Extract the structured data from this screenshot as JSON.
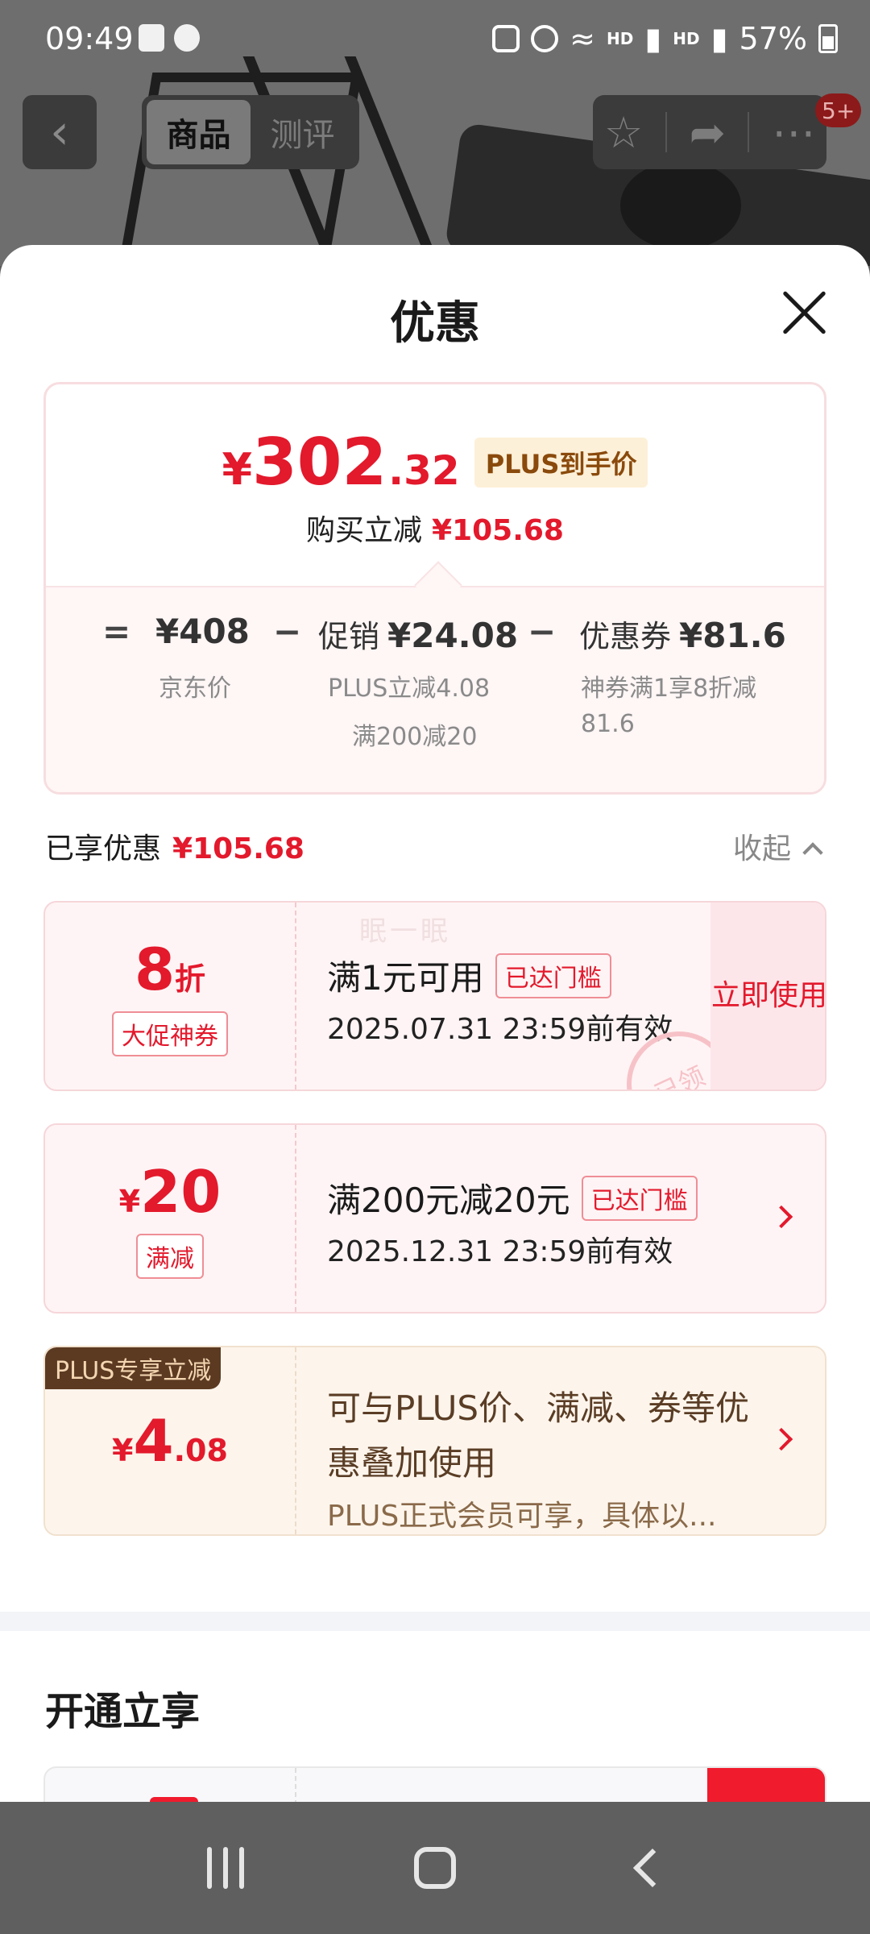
{
  "status_bar": {
    "time": "09:49",
    "battery": "57%",
    "network_a": "HD",
    "network_b": "HD"
  },
  "top_nav": {
    "tabs": [
      {
        "label": "商品",
        "active": true
      },
      {
        "label": "测评",
        "active": false
      }
    ],
    "more_badge": "5+"
  },
  "sheet": {
    "title": "优惠",
    "summary": {
      "currency": "¥",
      "price_int": "302",
      "price_dec": ".32",
      "price_tag": "PLUS到手价",
      "save_label": "购买立减",
      "save_amount": "¥105.68",
      "formula": {
        "eq": "=",
        "jd_price": "¥408",
        "jd_price_label": "京东价",
        "minus": "−",
        "promo_label": "促销",
        "promo_amount": "¥24.08",
        "promo_detail_1": "PLUS立减4.08",
        "promo_detail_2": "满200减20",
        "coupon_label": "优惠券",
        "coupon_amount": "¥81.6",
        "coupon_detail": "神券满1享8折减81.6"
      }
    },
    "enjoyed_label": "已享优惠",
    "enjoyed_amount": "¥105.68",
    "collapse_label": "收起",
    "coupons": [
      {
        "value_big": "8",
        "value_small": "折",
        "kind": "大促神券",
        "condition": "满1元可用",
        "reach": "已达门槛",
        "date": "2025.07.31 23:59前有效",
        "action": "立即使用",
        "stamp": "已领",
        "watermark": "眠一眠"
      },
      {
        "currency": "¥",
        "value_big": "20",
        "kind": "满减",
        "condition": "满200元减20元",
        "reach": "已达门槛",
        "date": "2025.12.31 23:59前有效"
      },
      {
        "corner": "PLUS专享立减",
        "currency": "¥",
        "value_big": "4",
        "value_small": ".08",
        "desc": "可与PLUS价、满减、券等优惠叠加使用",
        "sub": "PLUS正式会员可享，具体以..."
      }
    ],
    "open_title": "开通立享"
  },
  "colors": {
    "accent_red": "#e3192c",
    "plus_brown": "#5c3a22"
  }
}
